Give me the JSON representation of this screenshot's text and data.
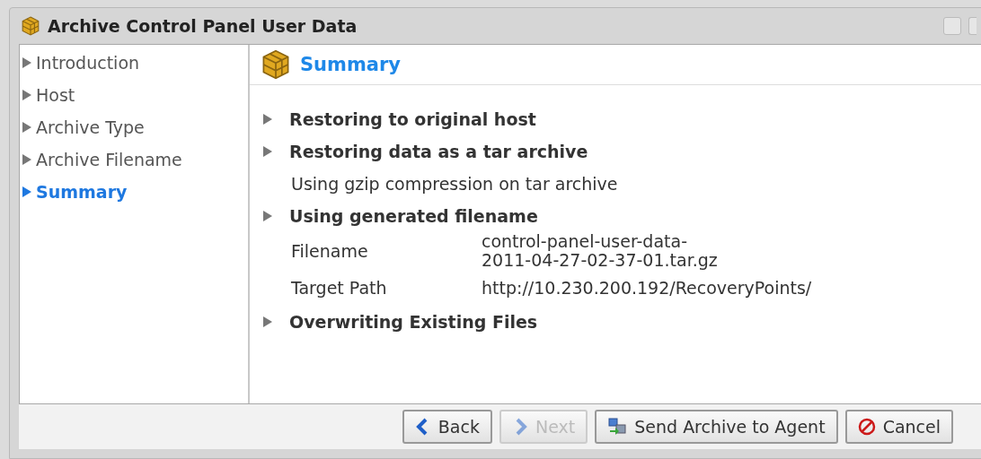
{
  "window": {
    "title": "Archive Control Panel User Data"
  },
  "sidebar": {
    "items": [
      {
        "label": "Introduction",
        "selected": false
      },
      {
        "label": "Host",
        "selected": false
      },
      {
        "label": "Archive Type",
        "selected": false
      },
      {
        "label": "Archive Filename",
        "selected": false
      },
      {
        "label": "Summary",
        "selected": true
      }
    ]
  },
  "panel": {
    "title": "Summary",
    "rows": [
      {
        "kind": "heading",
        "text": "Restoring to original host"
      },
      {
        "kind": "heading",
        "text": "Restoring data as a tar archive"
      },
      {
        "kind": "note",
        "text": "Using gzip compression on tar archive"
      },
      {
        "kind": "heading",
        "text": "Using generated filename"
      },
      {
        "kind": "field",
        "label": "Filename",
        "value_lines": [
          "control-panel-user-data-",
          "2011-04-27-02-37-01.tar.gz"
        ]
      },
      {
        "kind": "field",
        "label": "Target Path",
        "value_lines": [
          "http://10.230.200.192/RecoveryPoints/"
        ]
      },
      {
        "kind": "heading",
        "text": "Overwriting Existing Files"
      }
    ]
  },
  "buttons": [
    {
      "label": "Back",
      "kind": "back",
      "disabled": false
    },
    {
      "label": "Next",
      "kind": "next",
      "disabled": true
    },
    {
      "label": "Send Archive to Agent",
      "kind": "send",
      "disabled": false
    },
    {
      "label": "Cancel",
      "kind": "cancel",
      "disabled": false
    }
  ]
}
